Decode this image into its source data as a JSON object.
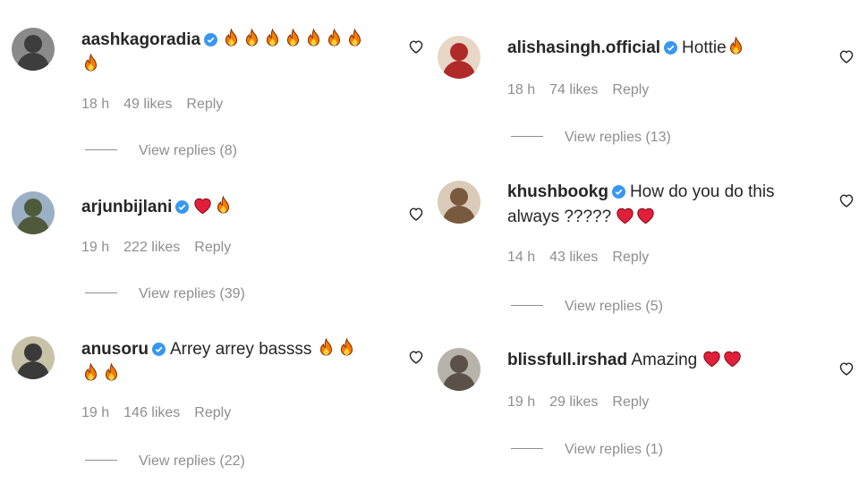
{
  "left": [
    {
      "username": "aashkagoradia",
      "text": "",
      "text_line2": "",
      "emojis": [
        "fire-icon",
        "fire-icon",
        "fire-icon",
        "fire-icon",
        "fire-icon",
        "fire-icon",
        "fire-icon"
      ],
      "emojis_line2": [
        "fire-icon"
      ],
      "time": "18 h",
      "likes": "49 likes",
      "reply": "Reply",
      "view_replies": "View replies (8)",
      "avatar": {
        "bg": "#8a8a8a",
        "fg": "#3d3d3d"
      }
    },
    {
      "username": "arjunbijlani",
      "text": "",
      "emojis": [
        "heart-icon",
        "fire-icon"
      ],
      "time": "19 h",
      "likes": "222 likes",
      "reply": "Reply",
      "view_replies": "View replies (39)",
      "avatar": {
        "bg": "#9bb0c4",
        "fg": "#4f5a3a"
      }
    },
    {
      "username": "anusoru",
      "text": "Arrey arrey bassss",
      "emojis": [
        "fire-icon",
        "fire-icon"
      ],
      "emojis_line2": [
        "fire-icon",
        "fire-icon"
      ],
      "time": "19 h",
      "likes": "146 likes",
      "reply": "Reply",
      "view_replies": "View replies (22)",
      "avatar": {
        "bg": "#c7c2a8",
        "fg": "#3a3a3a"
      }
    }
  ],
  "right": [
    {
      "username": "alishasingh.official",
      "text": "Hottie",
      "emojis": [
        "fire-icon"
      ],
      "time": "18 h",
      "likes": "74 likes",
      "reply": "Reply",
      "view_replies": "View replies (13)",
      "avatar": {
        "bg": "#e8d7c6",
        "fg": "#b02a2a"
      }
    },
    {
      "username": "khushbookg",
      "text": "How do you do this",
      "text_line2": "always ?????",
      "emojis_line2": [
        "heart-icon",
        "heart-icon"
      ],
      "time": "14 h",
      "likes": "43 likes",
      "reply": "Reply",
      "view_replies": "View replies (5)",
      "avatar": {
        "bg": "#d9cbb8",
        "fg": "#7a5a3e"
      }
    },
    {
      "username": "blissfull.irshad",
      "text": "Amazing",
      "emojis": [
        "heart-icon",
        "heart-icon"
      ],
      "time": "19 h",
      "likes": "29 likes",
      "reply": "Reply",
      "view_replies": "View replies (1)",
      "avatar": {
        "bg": "#b7b3ab",
        "fg": "#5a5248"
      }
    }
  ],
  "colors": {
    "text": "#262626",
    "muted": "#8e8e8e",
    "verified": "#3897f0",
    "heart": "#e0203a",
    "fire": "#f57c00"
  }
}
